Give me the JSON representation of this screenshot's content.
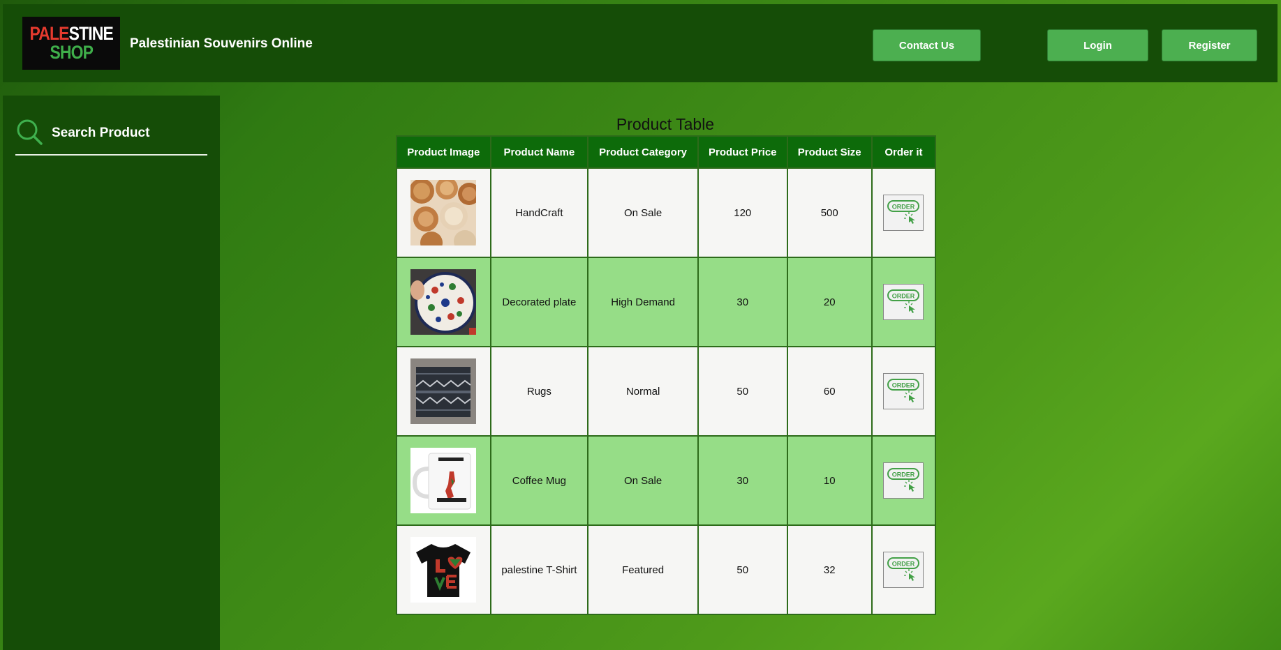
{
  "header": {
    "logo_line1_red": "PALE",
    "logo_line1_white": "STINE",
    "logo_line2": "SHOP",
    "site_title": "Palestinian Souvenirs Online",
    "contact_label": "Contact Us",
    "login_label": "Login",
    "register_label": "Register"
  },
  "sidebar": {
    "search_label": "Search Product",
    "search_icon": "search-icon"
  },
  "table": {
    "caption": "Product Table",
    "columns": [
      "Product Image",
      "Product Name",
      "Product Category",
      "Product Price",
      "Product Size",
      "Order it"
    ],
    "order_label": "ORDER",
    "rows": [
      {
        "image": "handcraft-bowls-image",
        "name": "HandCraft",
        "category": "On Sale",
        "price": "120",
        "size": "500"
      },
      {
        "image": "decorated-plate-image",
        "name": "Decorated plate",
        "category": "High Demand",
        "price": "30",
        "size": "20"
      },
      {
        "image": "rugs-image",
        "name": "Rugs",
        "category": "Normal",
        "price": "50",
        "size": "60"
      },
      {
        "image": "coffee-mug-image",
        "name": "Coffee Mug",
        "category": "On Sale",
        "price": "30",
        "size": "10"
      },
      {
        "image": "tshirt-image",
        "name": "palestine T-Shirt",
        "category": "Featured",
        "price": "50",
        "size": "32"
      }
    ]
  },
  "colors": {
    "header_bg": "#154d07",
    "button_bg": "#4caf50",
    "table_header_bg": "#0d6b0a",
    "row_odd": "#f6f6f4",
    "row_even": "#96dd87"
  }
}
